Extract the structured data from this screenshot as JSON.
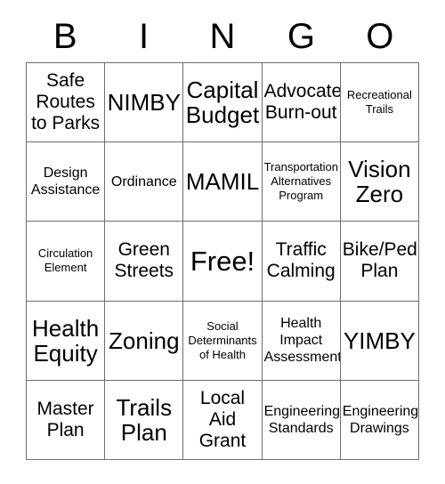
{
  "header": {
    "letters": [
      "B",
      "I",
      "N",
      "G",
      "O"
    ]
  },
  "grid": {
    "columns": 5,
    "rows": 5,
    "cells": [
      {
        "text": "Safe\nRoutes\nto Parks",
        "size": "md"
      },
      {
        "text": "NIMBY",
        "size": "lg"
      },
      {
        "text": "Capital\nBudget",
        "size": "lg"
      },
      {
        "text": "Advocate\nBurn-out",
        "size": "md"
      },
      {
        "text": "Recreational\nTrails",
        "size": "xs"
      },
      {
        "text": "Design\nAssistance",
        "size": "sm"
      },
      {
        "text": "Ordinance",
        "size": "sm"
      },
      {
        "text": "MAMIL",
        "size": "lg"
      },
      {
        "text": "Transportation\nAlternatives\nProgram",
        "size": "xs"
      },
      {
        "text": "Vision\nZero",
        "size": "lg"
      },
      {
        "text": "Circulation\nElement",
        "size": "xs"
      },
      {
        "text": "Green\nStreets",
        "size": "md"
      },
      {
        "text": "Free!",
        "size": "xl"
      },
      {
        "text": "Traffic\nCalming",
        "size": "md"
      },
      {
        "text": "Bike/Ped\nPlan",
        "size": "md"
      },
      {
        "text": "Health\nEquity",
        "size": "lg"
      },
      {
        "text": "Zoning",
        "size": "lg"
      },
      {
        "text": "Social\nDeterminants\nof Health",
        "size": "xs"
      },
      {
        "text": "Health\nImpact\nAssessment",
        "size": "sm"
      },
      {
        "text": "YIMBY",
        "size": "lg"
      },
      {
        "text": "Master\nPlan",
        "size": "md"
      },
      {
        "text": "Trails\nPlan",
        "size": "lg"
      },
      {
        "text": "Local\nAid\nGrant",
        "size": "md"
      },
      {
        "text": "Engineering\nStandards",
        "size": "sm"
      },
      {
        "text": "Engineering\nDrawings",
        "size": "sm"
      }
    ],
    "free_space_index": 12
  },
  "colors": {
    "background": "#ffffff",
    "text": "#000000",
    "border": "#6e6e6e"
  }
}
